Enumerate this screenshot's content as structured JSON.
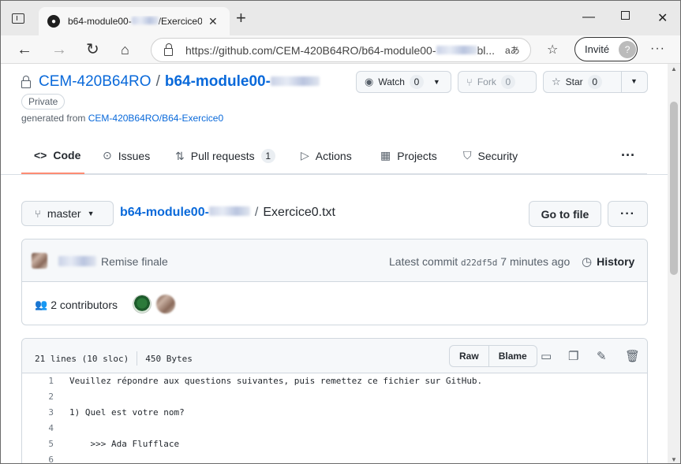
{
  "browser": {
    "tab_title": "b64-module00-",
    "tab_title_suffix": "/Exercice0",
    "url_prefix": "https://github.com/CEM-420B64RO/b64-module00-",
    "url_suffix": "bl...",
    "read_aloud": "aあ",
    "profile_label": "Invité"
  },
  "repo": {
    "owner": "CEM-420B64RO",
    "name": "b64-module00-",
    "visibility": "Private",
    "generated_prefix": "generated from",
    "template": "CEM-420B64RO/B64-Exercice0",
    "watch_label": "Watch",
    "watch_count": "0",
    "fork_label": "Fork",
    "fork_count": "0",
    "star_label": "Star",
    "star_count": "0"
  },
  "tabs": [
    {
      "label": "Code",
      "icon": "code-icon"
    },
    {
      "label": "Issues",
      "icon": "issue-icon"
    },
    {
      "label": "Pull requests",
      "icon": "pr-icon",
      "count": "1"
    },
    {
      "label": "Actions",
      "icon": "play-icon"
    },
    {
      "label": "Projects",
      "icon": "table-icon"
    },
    {
      "label": "Security",
      "icon": "shield-icon"
    }
  ],
  "filenav": {
    "branch": "master",
    "root": "b64-module00-",
    "file": "Exercice0.txt",
    "go_to_file": "Go to file"
  },
  "commit": {
    "message": "Remise finale",
    "latest_label": "Latest commit",
    "sha": "d22df5d",
    "time": "7 minutes ago",
    "history_label": "History",
    "contributors": "2 contributors"
  },
  "file": {
    "lines_info": "21 lines (10 sloc)",
    "size": "450 Bytes",
    "raw_label": "Raw",
    "blame_label": "Blame",
    "lines": [
      {
        "n": "1",
        "text": "Veuillez répondre aux questions suivantes, puis remettez ce fichier sur GitHub."
      },
      {
        "n": "2",
        "text": ""
      },
      {
        "n": "3",
        "text": "1) Quel est votre nom?"
      },
      {
        "n": "4",
        "text": ""
      },
      {
        "n": "5",
        "text": "    >>> Ada Flufflace"
      },
      {
        "n": "6",
        "text": ""
      }
    ]
  },
  "colors": {
    "link": "#0969da",
    "tab_underline": "#fd8c73",
    "border": "#d0d7de"
  }
}
